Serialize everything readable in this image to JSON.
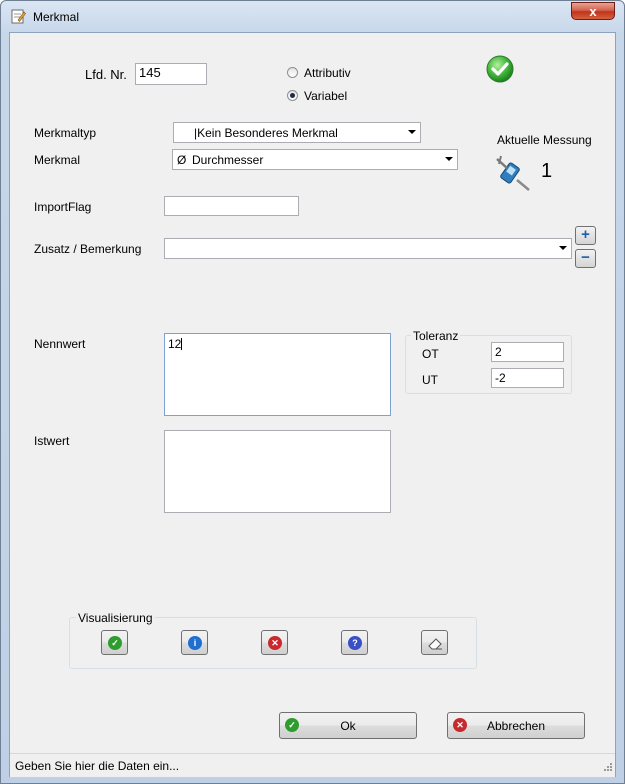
{
  "window": {
    "title": "Merkmal",
    "close_glyph": "x"
  },
  "form": {
    "lfd_nr_label": "Lfd. Nr.",
    "lfd_nr_value": "145",
    "radio_attributiv": "Attributiv",
    "radio_variabel": "Variabel",
    "selected_mode": "Variabel",
    "merkmaltyp_label": "Merkmaltyp",
    "merkmaltyp_value": "|Kein Besonderes Merkmal",
    "merkmal_label": "Merkmal",
    "merkmal_symbol": "Ø",
    "merkmal_value": "Durchmesser",
    "aktuelle_messung_label": "Aktuelle Messung",
    "aktuelle_messung_value": "1",
    "importflag_label": "ImportFlag",
    "importflag_value": "",
    "zusatz_label": "Zusatz / Bemerkung",
    "zusatz_value": "",
    "plus_glyph": "+",
    "minus_glyph": "−",
    "nennwert_label": "Nennwert",
    "nennwert_value": "12",
    "istwert_label": "Istwert",
    "istwert_value": "",
    "toleranz_title": "Toleranz",
    "ot_label": "OT",
    "ot_value": "2",
    "ut_label": "UT",
    "ut_value": "-2"
  },
  "visualisierung": {
    "title": "Visualisierung",
    "buttons": [
      {
        "icon": "green-check-icon",
        "color": "#2e9c2e",
        "glyph": "✓"
      },
      {
        "icon": "blue-info-icon",
        "color": "#1e6fd0",
        "glyph": "i"
      },
      {
        "icon": "red-x-icon",
        "color": "#c8292c",
        "glyph": "✕"
      },
      {
        "icon": "blue-question-icon",
        "color": "#3b4fc4",
        "glyph": "?"
      },
      {
        "icon": "eraser-icon",
        "color": "#9a9a9a",
        "glyph": ""
      }
    ]
  },
  "buttons": {
    "ok_label": "Ok",
    "ok_glyph": "✓",
    "cancel_label": "Abbrechen",
    "cancel_glyph": "✕"
  },
  "status": {
    "text": "Geben Sie hier die Daten ein..."
  },
  "colors": {
    "accent_green": "#2e9c2e",
    "accent_red": "#c8292c",
    "accent_blue": "#1e6fd0"
  }
}
